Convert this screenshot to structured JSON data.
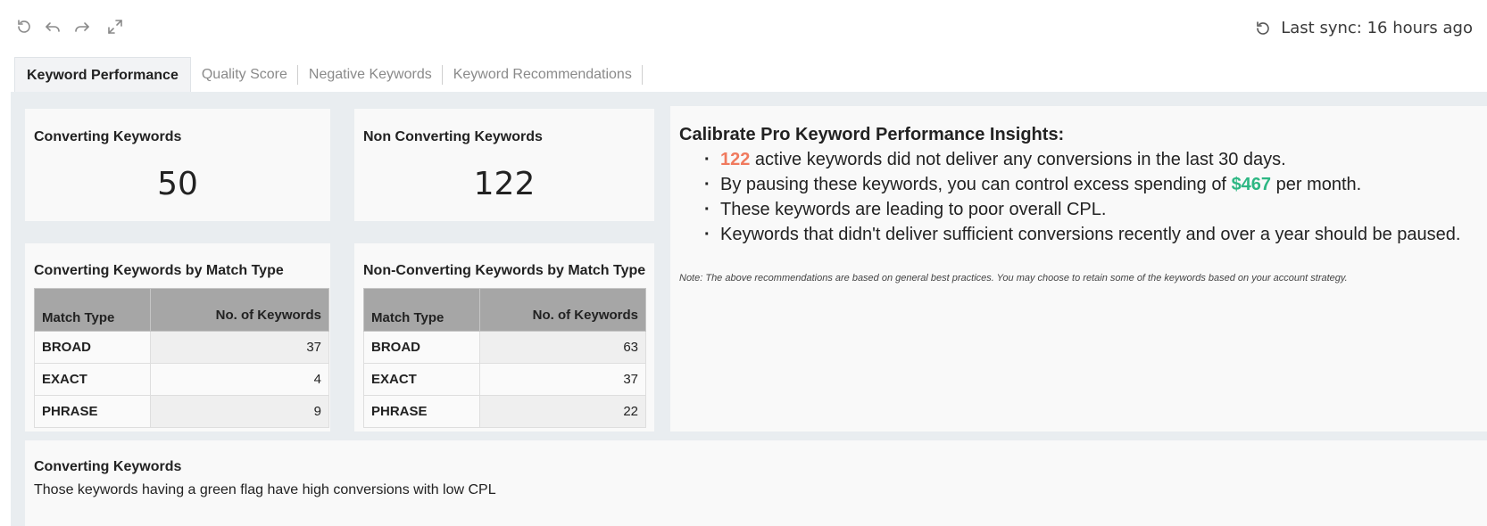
{
  "toolbar": {
    "icons": [
      "refresh-icon",
      "undo-icon",
      "redo-icon",
      "expand-icon"
    ],
    "sync_text": "Last sync: 16 hours ago"
  },
  "tabs": [
    {
      "label": "Keyword Performance",
      "active": true
    },
    {
      "label": "Quality Score",
      "active": false
    },
    {
      "label": "Negative Keywords",
      "active": false
    },
    {
      "label": "Keyword Recommendations",
      "active": false
    }
  ],
  "kpis": {
    "converting": {
      "title": "Converting Keywords",
      "value": "50"
    },
    "non_converting": {
      "title": "Non Converting Keywords",
      "value": "122"
    }
  },
  "match_tables": {
    "converting": {
      "title": "Converting Keywords by Match Type",
      "headers": [
        "Match Type",
        "No. of Keywords"
      ],
      "rows": [
        {
          "type": "BROAD",
          "count": "37"
        },
        {
          "type": "EXACT",
          "count": "4"
        },
        {
          "type": "PHRASE",
          "count": "9"
        }
      ]
    },
    "non_converting": {
      "title": "Non-Converting Keywords by Match Type",
      "headers": [
        "Match Type",
        "No. of Keywords"
      ],
      "rows": [
        {
          "type": "BROAD",
          "count": "63"
        },
        {
          "type": "EXACT",
          "count": "37"
        },
        {
          "type": "PHRASE",
          "count": "22"
        }
      ]
    }
  },
  "insights": {
    "title": "Calibrate Pro Keyword Performance Insights:",
    "item1_num": "122",
    "item1_rest": " active keywords did not deliver any conversions in the last 30 days.",
    "item2_pre": "By pausing these keywords, you can control excess spending of ",
    "item2_amount": "$467",
    "item2_post": " per month.",
    "item3": "These keywords are leading to poor overall CPL.",
    "item4": "Keywords that didn't deliver sufficient conversions recently and over a year should be paused.",
    "note": "Note: The above recommendations are based on general best practices. You may choose to retain some of the keywords based on your account strategy."
  },
  "bottom": {
    "title": "Converting Keywords",
    "subtitle": "Those keywords having a green flag have high conversions with low CPL"
  },
  "colors": {
    "highlight_red": "#f07a5e",
    "highlight_green": "#2db783",
    "table_header": "#a6a6a6",
    "content_bg": "#e9edf0"
  }
}
